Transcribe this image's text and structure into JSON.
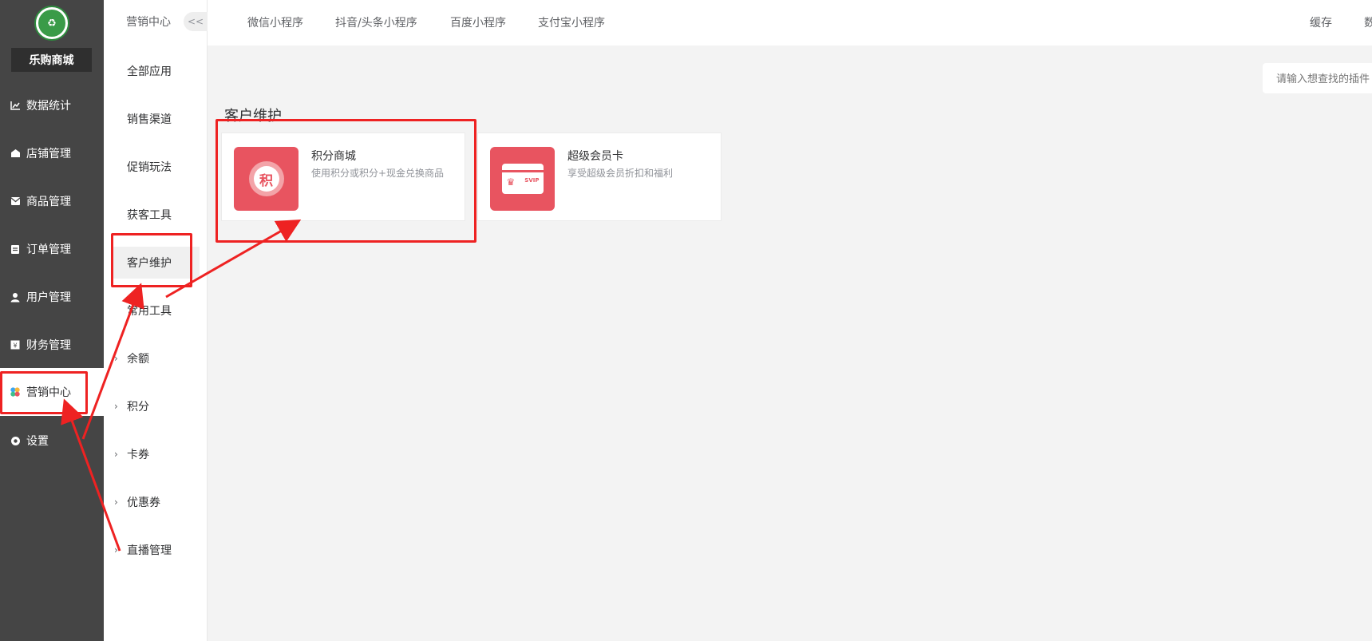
{
  "sidebar": {
    "logo_text": "♻",
    "shop_name": "乐购商城",
    "items": [
      {
        "label": "数据统计",
        "icon": "chart-icon"
      },
      {
        "label": "店铺管理",
        "icon": "store-icon"
      },
      {
        "label": "商品管理",
        "icon": "mail-icon"
      },
      {
        "label": "订单管理",
        "icon": "clipboard-icon"
      },
      {
        "label": "用户管理",
        "icon": "user-icon"
      },
      {
        "label": "财务管理",
        "icon": "finance-icon"
      },
      {
        "label": "营销中心",
        "icon": "marketing-icon",
        "active": true
      },
      {
        "label": "设置",
        "icon": "gear-icon"
      }
    ]
  },
  "submenu": {
    "title": "营销中心",
    "collapse_label": "<<",
    "items": [
      {
        "label": "全部应用"
      },
      {
        "label": "销售渠道"
      },
      {
        "label": "促销玩法"
      },
      {
        "label": "获客工具"
      },
      {
        "label": "客户维护",
        "active": true
      },
      {
        "label": "常用工具"
      },
      {
        "label": "余额"
      },
      {
        "label": "积分"
      },
      {
        "label": "卡券"
      },
      {
        "label": "优惠券"
      },
      {
        "label": "直播管理"
      }
    ]
  },
  "topbar": {
    "tabs": [
      "微信小程序",
      "抖音/头条小程序",
      "百度小程序",
      "支付宝小程序"
    ],
    "right_items": [
      "缓存",
      "数"
    ]
  },
  "search": {
    "placeholder": "请输入想查找的插件"
  },
  "main": {
    "section_title": "客户维护",
    "cards": [
      {
        "title": "积分商城",
        "desc": "使用积分或积分+现金兑换商品",
        "icon": "points-icon",
        "icon_char": "积"
      },
      {
        "title": "超级会员卡",
        "desc": "享受超级会员折扣和福利",
        "icon": "svip-card-icon",
        "icon_char": "SVIP"
      }
    ]
  },
  "colors": {
    "sidebar_bg": "#454545",
    "accent_red": "#e85460",
    "annotation_red": "#ee2222"
  }
}
